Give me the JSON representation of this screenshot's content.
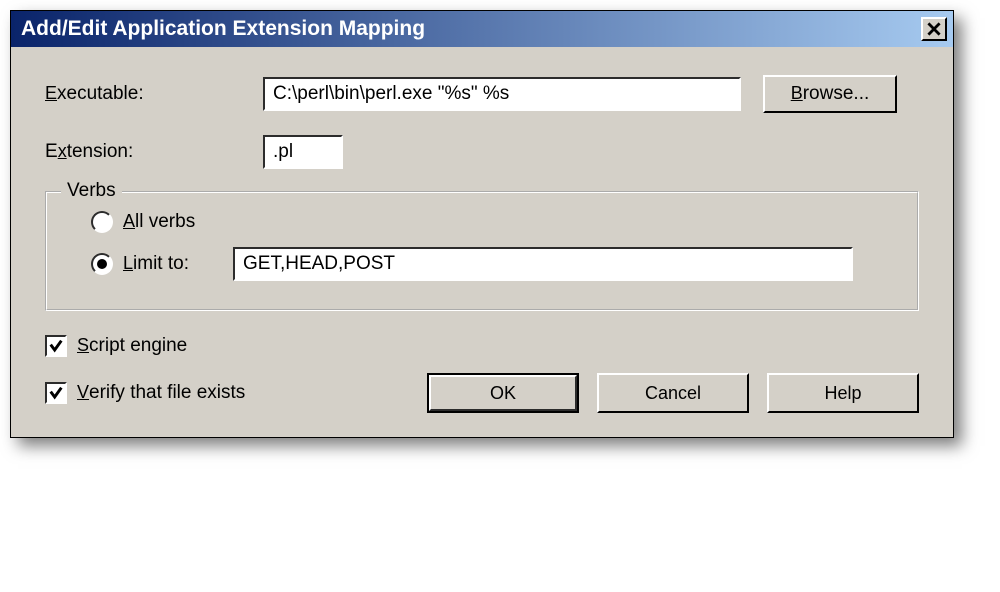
{
  "title": "Add/Edit Application Extension Mapping",
  "fields": {
    "executable_label": "Executable:",
    "executable_value": "C:\\perl\\bin\\perl.exe \"%s\" %s",
    "extension_label": "Extension:",
    "extension_value": ".pl"
  },
  "verbs": {
    "legend": "Verbs",
    "all_verbs_label": "All verbs",
    "limit_to_label": "Limit to:",
    "limit_to_value": "GET,HEAD,POST",
    "selected": "limit_to"
  },
  "checkboxes": {
    "script_engine_label": "Script engine",
    "script_engine_checked": true,
    "verify_exists_label": "Verify that file exists",
    "verify_exists_checked": true
  },
  "buttons": {
    "browse": "Browse...",
    "ok": "OK",
    "cancel": "Cancel",
    "help": "Help"
  }
}
